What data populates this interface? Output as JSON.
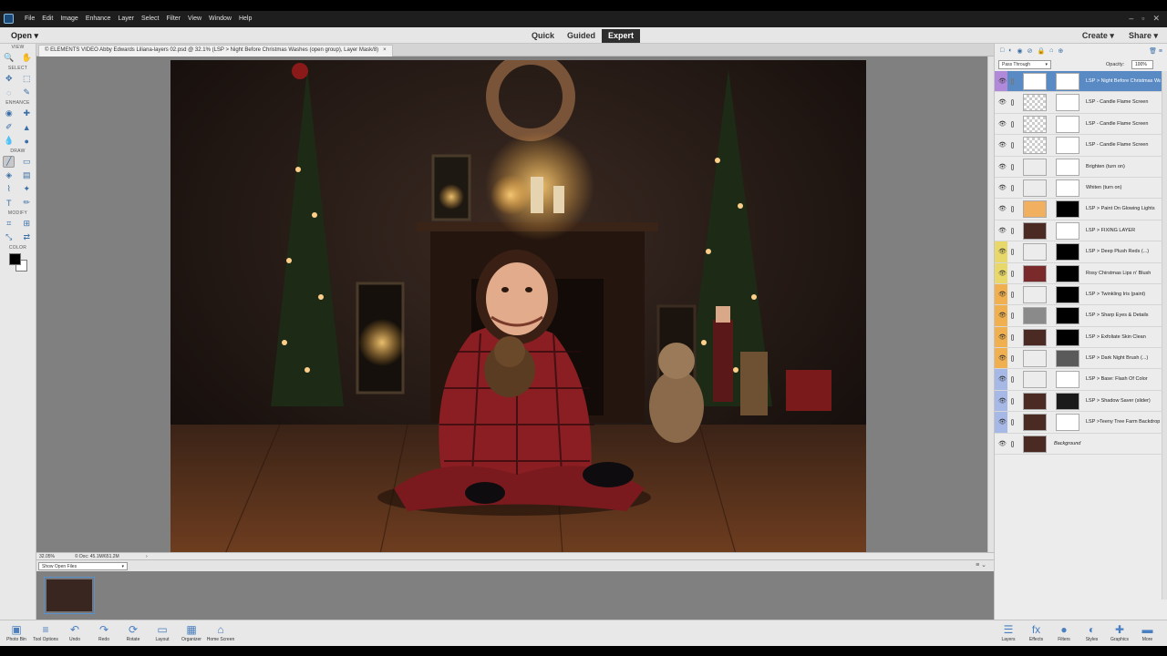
{
  "menu": {
    "items": [
      "File",
      "Edit",
      "Image",
      "Enhance",
      "Layer",
      "Select",
      "Filter",
      "View",
      "Window",
      "Help"
    ],
    "window_controls": [
      "–",
      "▫",
      "✕"
    ]
  },
  "modebar": {
    "open_label": "Open",
    "open_caret": "▾",
    "modes": [
      "Quick",
      "Guided",
      "Expert"
    ],
    "active_mode": "Expert",
    "create_label": "Create",
    "share_label": "Share",
    "caret": "▾"
  },
  "toolbox": {
    "sections": [
      "VIEW",
      "SELECT",
      "ENHANCE",
      "DRAW",
      "MODIFY",
      "COLOR"
    ],
    "view_tools": [
      "zoom-icon",
      "hand-icon"
    ],
    "select_tools": [
      "move-icon",
      "marquee-icon",
      "lasso-icon",
      "quick-select-icon"
    ],
    "enhance_tools": [
      "eye-icon",
      "spot-heal-icon",
      "smart-brush-icon",
      "clone-stamp-icon",
      "blur-icon",
      "sponge-icon"
    ],
    "draw_tools": [
      "brush-icon",
      "eraser-icon",
      "paint-bucket-icon",
      "gradient-icon",
      "color-picker-icon",
      "custom-shape-icon",
      "type-icon",
      "pencil-icon"
    ],
    "modify_tools": [
      "crop-icon",
      "recompose-icon",
      "straighten-icon",
      "content-move-icon"
    ],
    "glyphs": {
      "zoom-icon": "🔍",
      "hand-icon": "✋",
      "move-icon": "✥",
      "marquee-icon": "⬚",
      "lasso-icon": "◌",
      "quick-select-icon": "✎",
      "eye-icon": "◉",
      "spot-heal-icon": "✚",
      "smart-brush-icon": "✐",
      "clone-stamp-icon": "▲",
      "blur-icon": "💧",
      "sponge-icon": "●",
      "brush-icon": "╱",
      "eraser-icon": "▭",
      "paint-bucket-icon": "◈",
      "gradient-icon": "▤",
      "color-picker-icon": "⌇",
      "custom-shape-icon": "✦",
      "type-icon": "T",
      "pencil-icon": "✏",
      "crop-icon": "⌗",
      "recompose-icon": "⊞",
      "straighten-icon": "⤡",
      "content-move-icon": "⇄"
    }
  },
  "document": {
    "tab_title": "© ELEMENTS VIDEO Abby Edwards Liliana-layers 02.psd @ 32.1% (LSP > Night Before Christmas Washes (open group), Layer Mask/8)",
    "close": "×",
    "zoom": "32.05%",
    "doc_info": "© Doc: 45.1M/651.2M",
    "status_caret": "›"
  },
  "photo_bin": {
    "dropdown_label": "Show Open Files",
    "caret": "▾",
    "icons": "≡ ⌄"
  },
  "bottom_left": [
    {
      "label": "Photo Bin",
      "icon": "▣"
    },
    {
      "label": "Tool Options",
      "icon": "≡"
    },
    {
      "label": "Undo",
      "icon": "↶"
    },
    {
      "label": "Redo",
      "icon": "↷"
    },
    {
      "label": "Rotate",
      "icon": "⟳"
    },
    {
      "label": "Layout",
      "icon": "▭"
    },
    {
      "label": "Organizer",
      "icon": "▦"
    },
    {
      "label": "Home Screen",
      "icon": "⌂"
    }
  ],
  "bottom_right": [
    {
      "label": "Layers",
      "icon": "☰"
    },
    {
      "label": "Effects",
      "icon": "fx"
    },
    {
      "label": "Filters",
      "icon": "●"
    },
    {
      "label": "Styles",
      "icon": "◐"
    },
    {
      "label": "Graphics",
      "icon": "✚"
    },
    {
      "label": "More",
      "icon": "▬"
    }
  ],
  "layers_panel": {
    "blend_mode": "Pass Through",
    "opacity_label": "Opacity:",
    "opacity_value": "100%",
    "top_icons": [
      "□",
      "◐",
      "◉",
      "⊘",
      "🔒",
      "⌂",
      "⊕"
    ],
    "trash_icon": "🗑",
    "menu_icon": "≡",
    "visibility_icon": "👁",
    "layers": [
      {
        "name": "LSP > Night Before Christmas Washes",
        "color": "#b08ad8",
        "thumb": "#ffffff",
        "mask": "#ffffff",
        "selected": true
      },
      {
        "name": "LSP - Candle Flame Screen",
        "color": "",
        "thumb": "checker",
        "mask": "#ffffff"
      },
      {
        "name": "LSP - Candle Flame Screen",
        "color": "",
        "thumb": "checker",
        "mask": "#ffffff"
      },
      {
        "name": "LSP - Candle Flame Screen",
        "color": "",
        "thumb": "checker",
        "mask": "#ffffff"
      },
      {
        "name": "Brighten (turn on)",
        "color": "",
        "thumb": "#ececec",
        "mask": "#ffffff"
      },
      {
        "name": "Whiten (turn on)",
        "color": "",
        "thumb": "#ececec",
        "mask": "#ffffff"
      },
      {
        "name": "LSP > Paint On Glowing Lights",
        "color": "",
        "thumb": "#f0b060",
        "mask": "#000000"
      },
      {
        "name": "LSP > FIXING LAYER",
        "color": "",
        "thumb": "#4a2a22",
        "mask": "#ffffff"
      },
      {
        "name": "LSP > Deep Plush Reds (...)",
        "color": "#e8d86a",
        "thumb": "#ececec",
        "mask": "#000000"
      },
      {
        "name": "Rosy Chirstmas Lips n' Blush",
        "color": "#e8d86a",
        "thumb": "#7a2a2a",
        "mask": "#000000"
      },
      {
        "name": "LSP > Twinkling Iris (paint)",
        "color": "#f0b050",
        "thumb": "#ececec",
        "mask": "#000000"
      },
      {
        "name": "LSP > Sharp Eyes & Details",
        "color": "#f0b050",
        "thumb": "#8a8a8a",
        "mask": "#000000"
      },
      {
        "name": "LSP > Exfoliate Skin Clean",
        "color": "#f0b050",
        "thumb": "#4a2a22",
        "mask": "#000000"
      },
      {
        "name": "LSP > Dark Night Brush (...)",
        "color": "#f0b050",
        "thumb": "#ececec",
        "mask": "#5a5a5a"
      },
      {
        "name": "LSP > Base: Flash Of Color",
        "color": "#a6b8e6",
        "thumb": "#ececec",
        "mask": "#ffffff"
      },
      {
        "name": "LSP > Shadow Saver (slider)",
        "color": "#a6b8e6",
        "thumb": "#4a2a22",
        "mask": "#1a1a1a"
      },
      {
        "name": "LSP >Teeny Tree Farm Backdrop",
        "color": "#a6b8e6",
        "thumb": "#4a2a22",
        "mask": "#ffffff"
      },
      {
        "name": "Background",
        "color": "",
        "thumb": "#4a2a22",
        "mask": "",
        "italic": true
      }
    ]
  }
}
